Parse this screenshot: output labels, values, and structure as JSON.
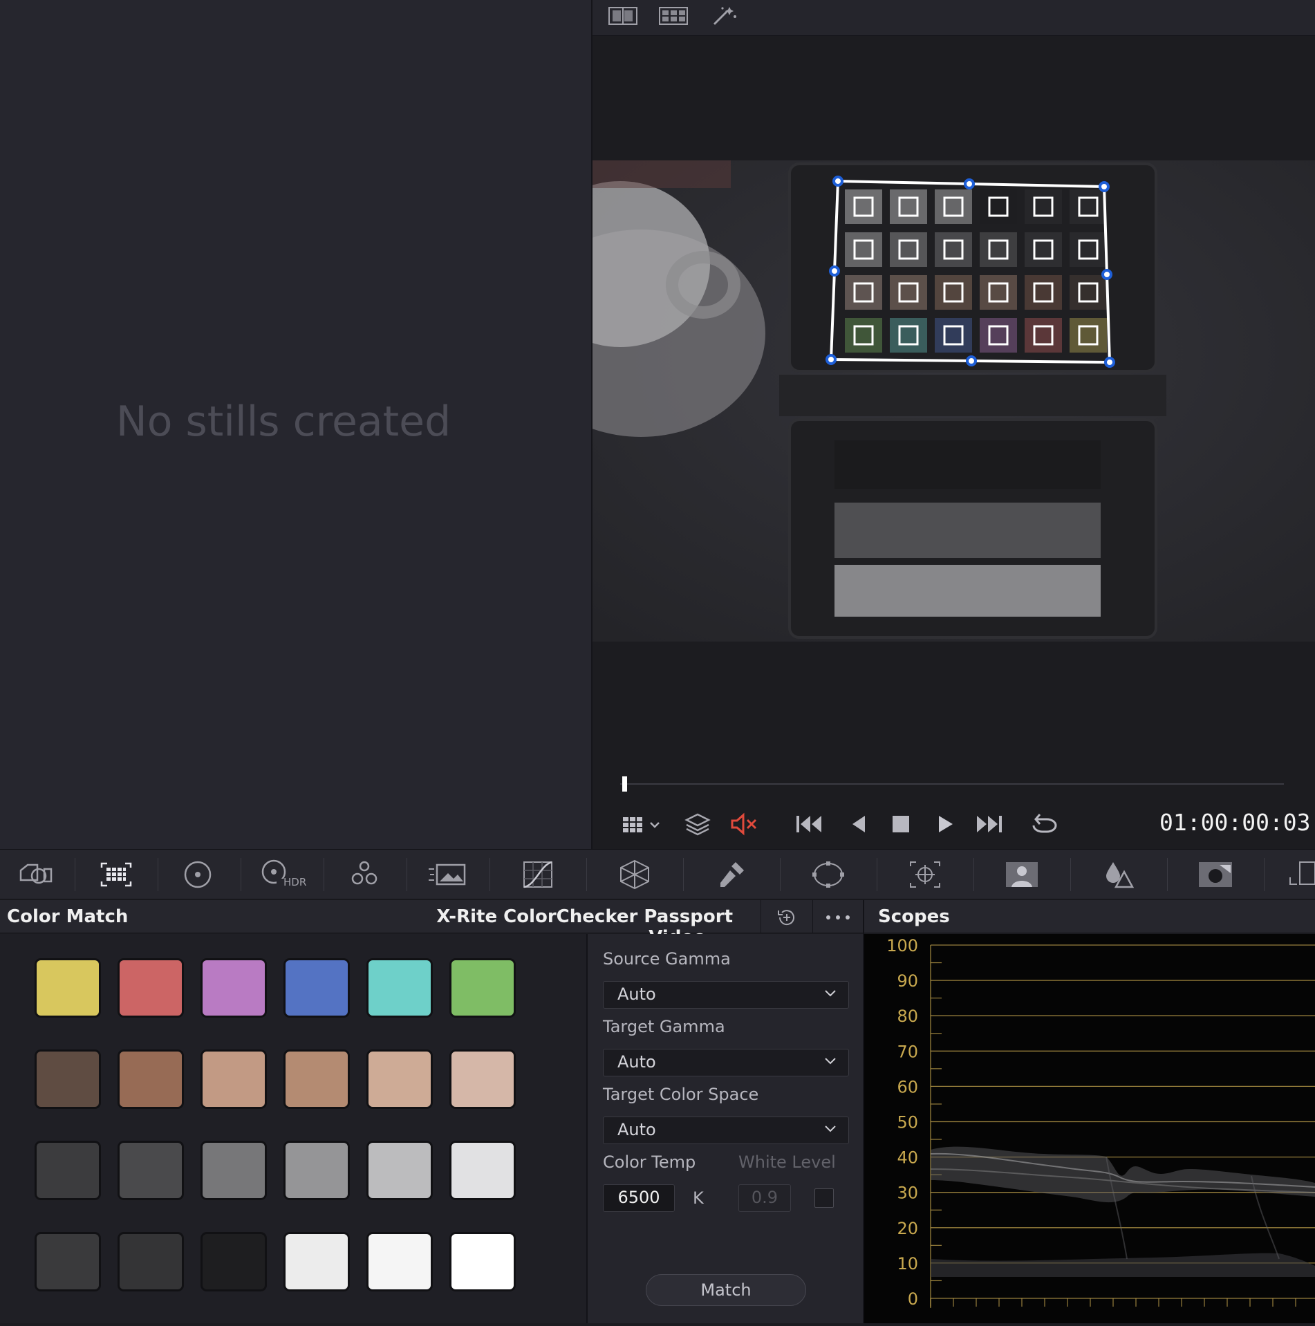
{
  "gallery": {
    "empty_message": "No stills created"
  },
  "viewer": {
    "toolbar_icons": [
      "split-screen-icon",
      "grid-view-icon",
      "magic-wand-icon"
    ],
    "timecode": "01:00:00:03",
    "transport_icons": [
      "wipe-grid-icon",
      "layers-icon",
      "mute-icon",
      "go-to-start-icon",
      "previous-frame-icon",
      "stop-icon",
      "play-icon",
      "go-to-end-icon",
      "loop-icon"
    ],
    "colors": {
      "mute": "#e04a3c",
      "control_point": "#1e5fd8"
    }
  },
  "palette_bar": {
    "icons": [
      "camera-raw-icon",
      "color-match-icon",
      "primary-wheels-icon",
      "hdr-wheels-icon",
      "rgb-mixer-icon",
      "motion-effects-icon",
      "curves-icon",
      "color-warper-icon",
      "qualifier-icon",
      "power-window-icon",
      "tracker-icon",
      "magic-mask-icon",
      "blur-icon",
      "key-icon",
      "sizing-icon"
    ],
    "hdr_label": "HDR"
  },
  "color_match": {
    "title": "Color Match",
    "chart_name": "X-Rite ColorChecker Passport Video",
    "swatches": [
      [
        "#d8c75e",
        "#cc6565",
        "#b97bc3",
        "#5473c3",
        "#6ed0c9",
        "#7fbd65"
      ],
      [
        "#5f4c42",
        "#976b55",
        "#c29a84",
        "#b48b72",
        "#ceab96",
        "#d5b7a8"
      ],
      [
        "#3c3c3e",
        "#4a4a4c",
        "#777779",
        "#959597",
        "#bcbcbe",
        "#e1e1e3"
      ],
      [
        "#3a3a3c",
        "#343436",
        "#1e1e20",
        "#ececec",
        "#f5f5f5",
        "#ffffff"
      ]
    ],
    "source_gamma_label": "Source Gamma",
    "source_gamma_value": "Auto",
    "target_gamma_label": "Target Gamma",
    "target_gamma_value": "Auto",
    "target_color_space_label": "Target Color Space",
    "target_color_space_value": "Auto",
    "color_temp_label": "Color Temp",
    "color_temp_value": "6500",
    "color_temp_unit": "K",
    "white_level_label": "White Level",
    "white_level_value": "0.9",
    "match_label": "Match"
  },
  "scopes": {
    "title": "Scopes",
    "ticks": [
      "100",
      "90",
      "80",
      "70",
      "60",
      "50",
      "40",
      "30",
      "20",
      "10",
      "0"
    ],
    "tick_color": "#c9a94f"
  }
}
